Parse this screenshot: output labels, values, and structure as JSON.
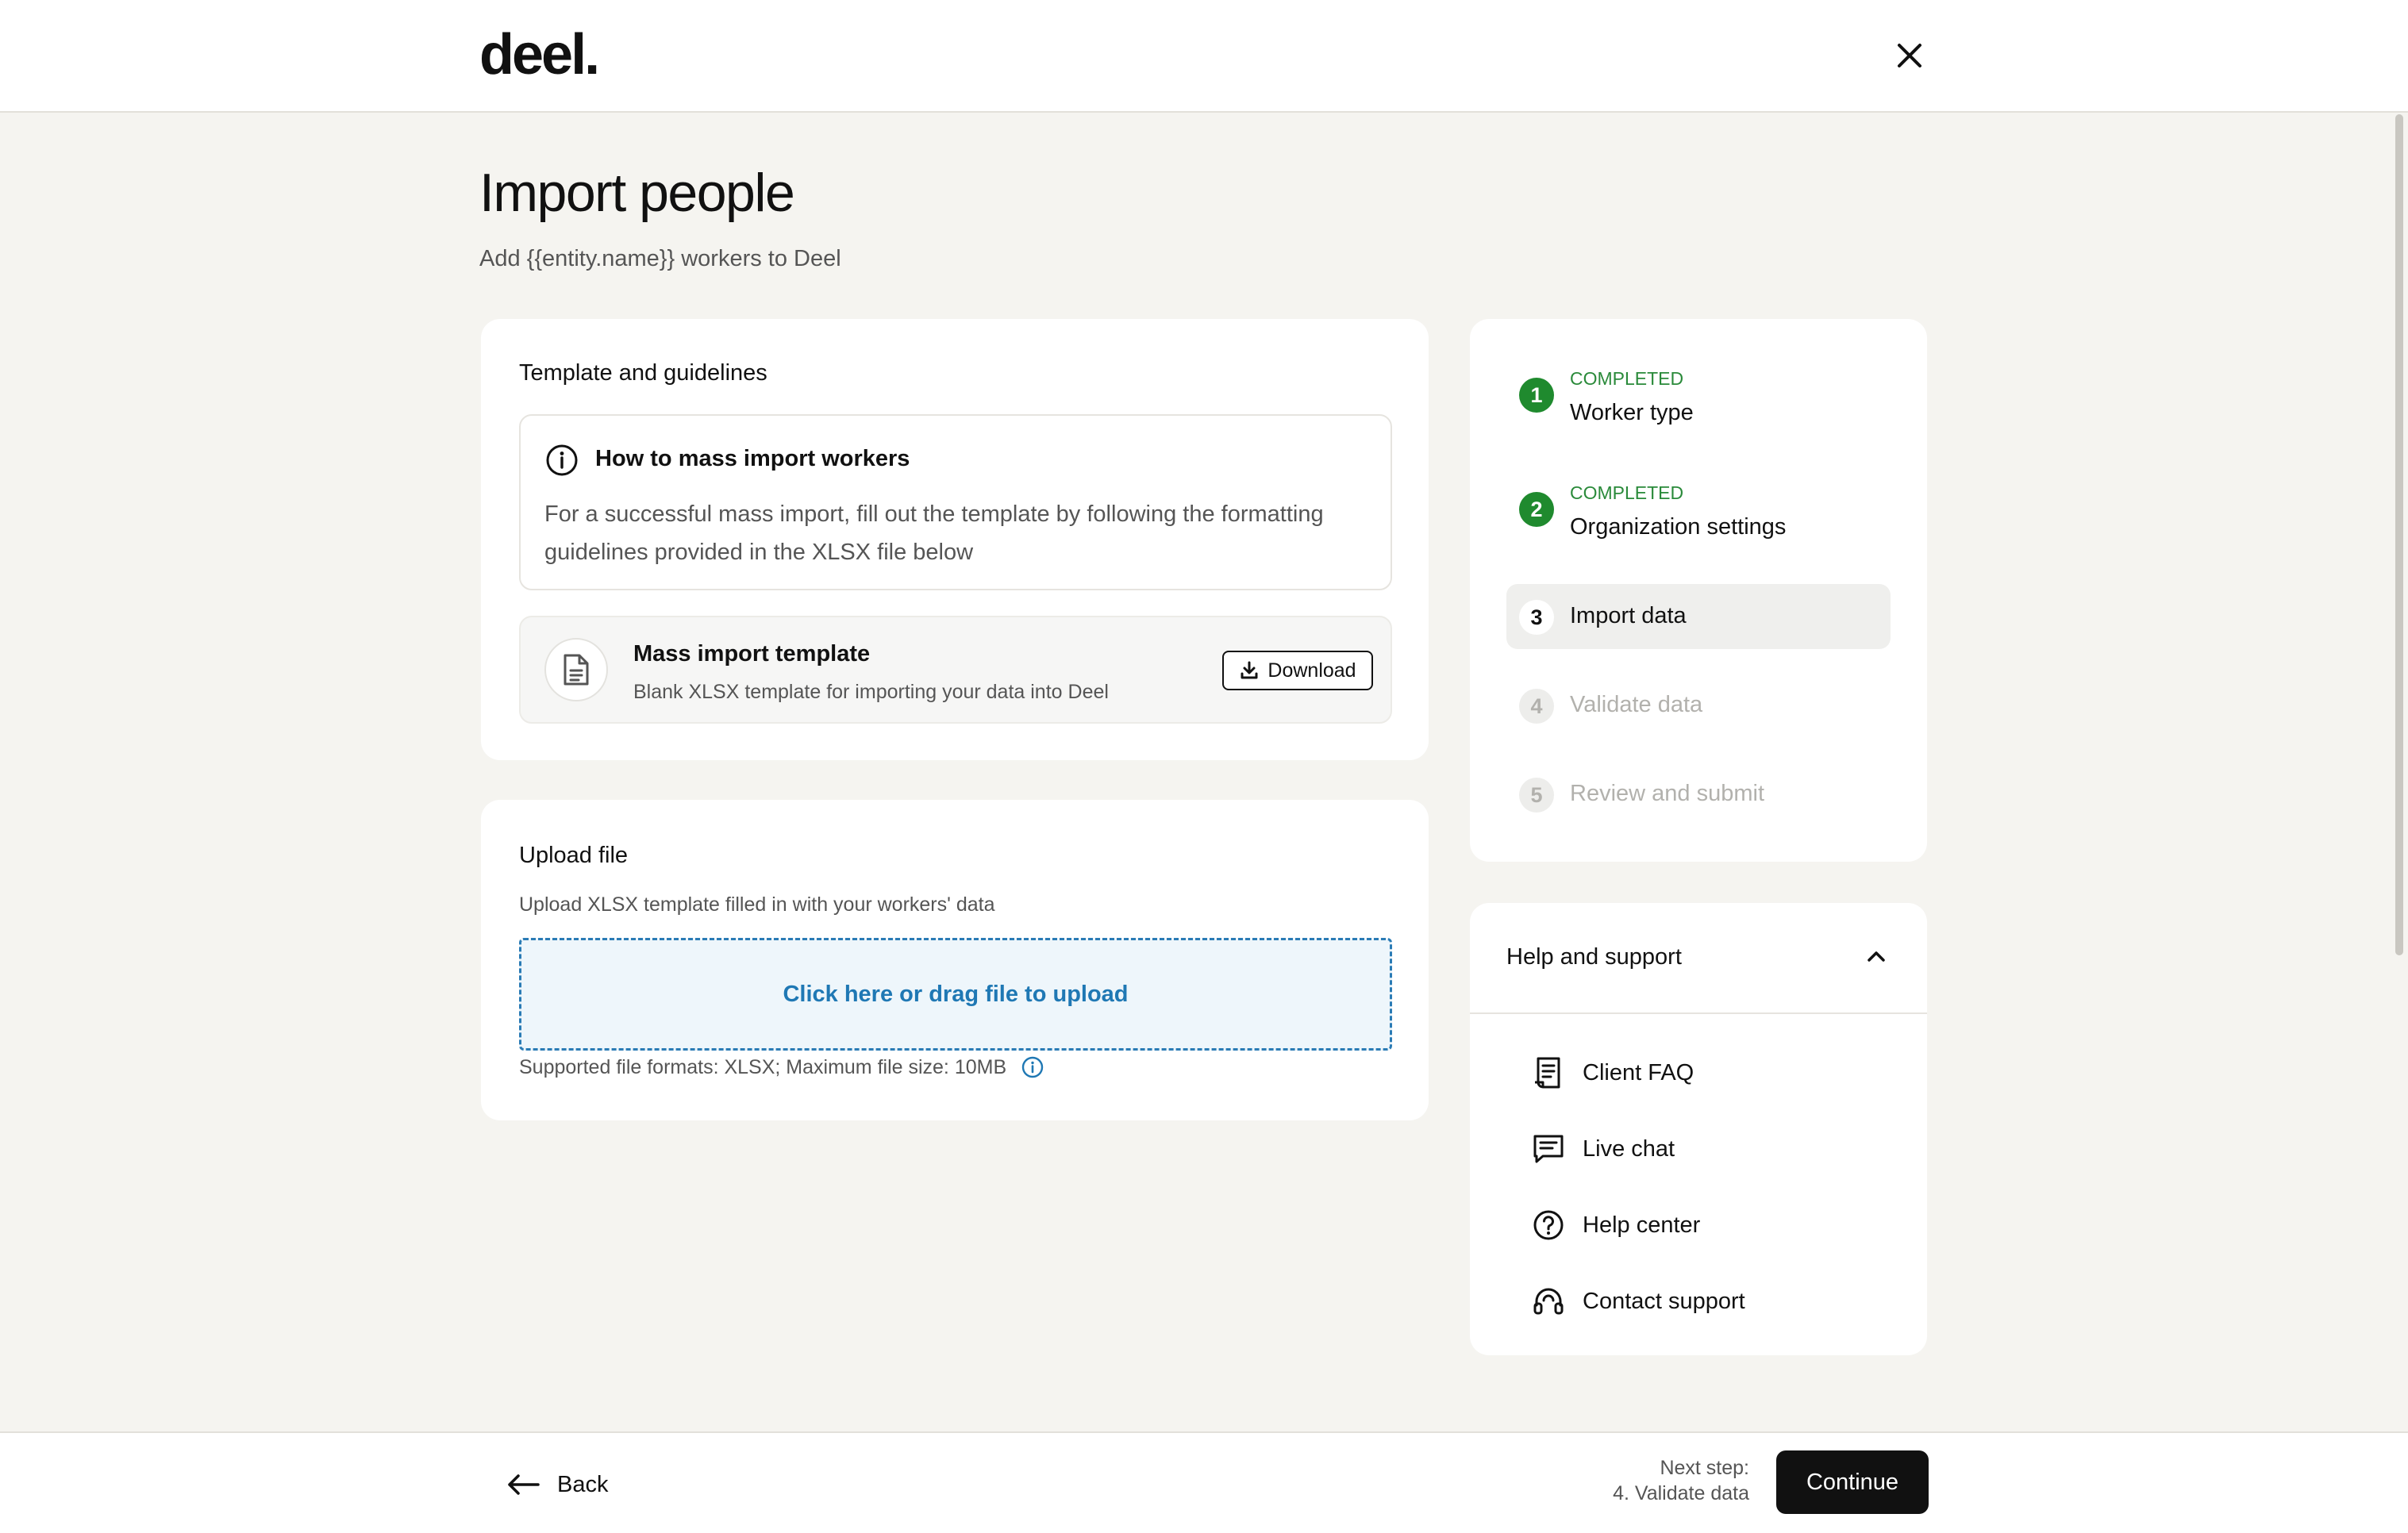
{
  "header": {
    "logo": "deel."
  },
  "page": {
    "title": "Import people",
    "subtitle": "Add {{entity.name}} workers to Deel"
  },
  "template_card": {
    "title": "Template and guidelines",
    "info": {
      "title": "How to mass import workers",
      "body": "For a successful mass import, fill out the template by following the formatting guidelines provided in the XLSX file below"
    },
    "template": {
      "title": "Mass import template",
      "description": "Blank XLSX template for importing your data into Deel",
      "download_label": "Download"
    }
  },
  "upload_card": {
    "title": "Upload file",
    "description": "Upload XLSX template filled in with your workers' data",
    "dropzone_label": "Click here or drag file to upload",
    "formats": "Supported file formats: XLSX; Maximum file size: 10MB"
  },
  "steps": [
    {
      "number": "1",
      "status": "COMPLETED",
      "label": "Worker type"
    },
    {
      "number": "2",
      "status": "COMPLETED",
      "label": "Organization settings"
    },
    {
      "number": "3",
      "status": "",
      "label": "Import data"
    },
    {
      "number": "4",
      "status": "",
      "label": "Validate data"
    },
    {
      "number": "5",
      "status": "",
      "label": "Review and submit"
    }
  ],
  "help": {
    "title": "Help and support",
    "items": [
      {
        "label": "Client FAQ",
        "icon": "faq-document-icon"
      },
      {
        "label": "Live chat",
        "icon": "chat-bubble-icon"
      },
      {
        "label": "Help center",
        "icon": "question-circle-icon"
      },
      {
        "label": "Contact support",
        "icon": "headset-icon"
      }
    ]
  },
  "footer": {
    "back_label": "Back",
    "next_step_label": "Next step:",
    "next_step_value": "4. Validate data",
    "continue_label": "Continue"
  },
  "colors": {
    "accent_green": "#1f8a2e",
    "link_blue": "#1f78b4",
    "background": "#f5f4f0"
  }
}
